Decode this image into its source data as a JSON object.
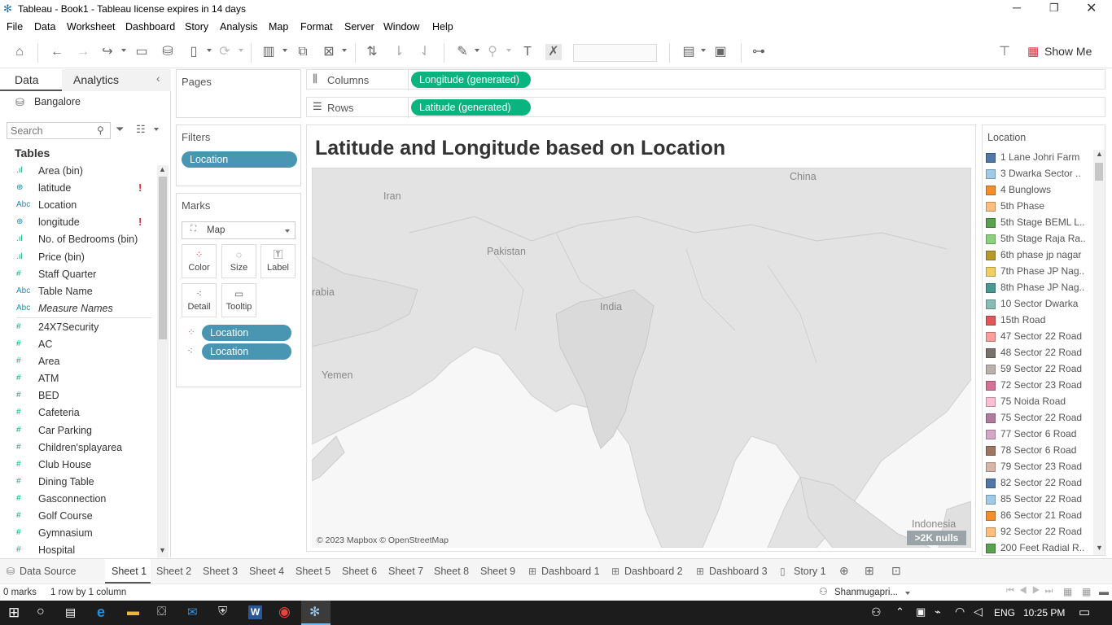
{
  "window": {
    "title": "Tableau - Book1 - Tableau license expires in 14 days"
  },
  "menu": [
    "File",
    "Data",
    "Worksheet",
    "Dashboard",
    "Story",
    "Analysis",
    "Map",
    "Format",
    "Server",
    "Window",
    "Help"
  ],
  "toolbar": {
    "show_me": "Show Me"
  },
  "data_pane": {
    "tab_data": "Data",
    "tab_analytics": "Analytics",
    "datasource": "Bangalore",
    "search_placeholder": "Search",
    "tables_label": "Tables",
    "fields": [
      {
        "icon": "bin",
        "label": "Area (bin)",
        "warn": ""
      },
      {
        "icon": "geo",
        "label": "latitude",
        "warn": "!"
      },
      {
        "icon": "abc",
        "label": "Location",
        "warn": ""
      },
      {
        "icon": "geo",
        "label": "longitude",
        "warn": "!"
      },
      {
        "icon": "bin",
        "label": "No. of Bedrooms (bin)",
        "warn": ""
      },
      {
        "icon": "bin",
        "label": "Price (bin)",
        "warn": ""
      },
      {
        "icon": "num",
        "label": "Staff Quarter",
        "warn": ""
      },
      {
        "icon": "abc",
        "label": "Table Name",
        "warn": ""
      },
      {
        "icon": "abc",
        "label": "Measure Names",
        "warn": ""
      },
      {
        "icon": "num",
        "label": "24X7Security",
        "warn": ""
      },
      {
        "icon": "num",
        "label": "AC",
        "warn": ""
      },
      {
        "icon": "num",
        "label": "Area",
        "warn": ""
      },
      {
        "icon": "num",
        "label": "ATM",
        "warn": ""
      },
      {
        "icon": "num",
        "label": "BED",
        "warn": ""
      },
      {
        "icon": "num",
        "label": "Cafeteria",
        "warn": ""
      },
      {
        "icon": "num",
        "label": "Car Parking",
        "warn": ""
      },
      {
        "icon": "num",
        "label": "Children'splayarea",
        "warn": ""
      },
      {
        "icon": "num",
        "label": "Club House",
        "warn": ""
      },
      {
        "icon": "num",
        "label": "Dining Table",
        "warn": ""
      },
      {
        "icon": "num",
        "label": "Gasconnection",
        "warn": ""
      },
      {
        "icon": "num",
        "label": "Golf Course",
        "warn": ""
      },
      {
        "icon": "num",
        "label": "Gymnasium",
        "warn": ""
      },
      {
        "icon": "num",
        "label": "Hospital",
        "warn": ""
      }
    ]
  },
  "shelves": {
    "pages": "Pages",
    "filters": "Filters",
    "filter_pill": "Location",
    "marks": "Marks",
    "mark_type": "Map",
    "mark_buttons": [
      "Color",
      "Size",
      "Label",
      "Detail",
      "Tooltip"
    ],
    "mark_pills": [
      "Location",
      "Location"
    ],
    "columns": "Columns",
    "rows": "Rows",
    "columns_pill": "Longitude (generated)",
    "rows_pill": "Latitude (generated)"
  },
  "view": {
    "title": "Latitude and Longitude based on Location",
    "attribution": "© 2023 Mapbox © OpenStreetMap",
    "nulls": ">2K nulls",
    "map_labels": [
      "China",
      "Iran",
      "Pakistan",
      "rabia",
      "India",
      "Yemen",
      "Indonesia"
    ]
  },
  "legend": {
    "title": "Location",
    "items": [
      {
        "label": "1 Lane Johri Farm",
        "color": "#4e79a7"
      },
      {
        "label": "3 Dwarka Sector ..",
        "color": "#a0cbe8"
      },
      {
        "label": "4 Bunglows",
        "color": "#f28e2b"
      },
      {
        "label": "5th Phase",
        "color": "#ffbe7d"
      },
      {
        "label": "5th Stage BEML L..",
        "color": "#59a14f"
      },
      {
        "label": "5th Stage Raja Ra..",
        "color": "#8cd17d"
      },
      {
        "label": "6th phase jp nagar",
        "color": "#b6992d"
      },
      {
        "label": "7th Phase JP Nag..",
        "color": "#f1ce63"
      },
      {
        "label": "8th Phase JP Nag..",
        "color": "#499894"
      },
      {
        "label": "10 Sector Dwarka",
        "color": "#86bcb6"
      },
      {
        "label": "15th Road",
        "color": "#e15759"
      },
      {
        "label": "47 Sector 22 Road",
        "color": "#ff9d9a"
      },
      {
        "label": "48 Sector 22 Road",
        "color": "#79706e"
      },
      {
        "label": "59 Sector 22 Road",
        "color": "#bab0ac"
      },
      {
        "label": "72 Sector 23 Road",
        "color": "#d37295"
      },
      {
        "label": "75 Noida Road",
        "color": "#fabfd2"
      },
      {
        "label": "75 Sector 22 Road",
        "color": "#b07aa1"
      },
      {
        "label": "77 Sector 6 Road",
        "color": "#d4a6c8"
      },
      {
        "label": "78 Sector 6 Road",
        "color": "#9d7660"
      },
      {
        "label": "79 Sector 23 Road",
        "color": "#d7b5a6"
      },
      {
        "label": "82 Sector 22 Road",
        "color": "#4e79a7"
      },
      {
        "label": "85 Sector 22 Road",
        "color": "#a0cbe8"
      },
      {
        "label": "86 Sector 21 Road",
        "color": "#f28e2b"
      },
      {
        "label": "92 Sector 22 Road",
        "color": "#ffbe7d"
      },
      {
        "label": "200 Feet Radial R..",
        "color": "#59a14f"
      }
    ]
  },
  "sheet_tabs": [
    "Data Source",
    "Sheet 1",
    "Sheet 2",
    "Sheet 3",
    "Sheet 4",
    "Sheet 5",
    "Sheet 6",
    "Sheet 7",
    "Sheet 8",
    "Sheet 9",
    "Dashboard 1",
    "Dashboard 2",
    "Dashboard 3",
    "Story 1"
  ],
  "status": {
    "marks": "0 marks",
    "rows_cols": "1 row by 1 column",
    "user": "Shanmugapri..."
  },
  "taskbar": {
    "lang": "ENG",
    "time": "10:25 PM"
  }
}
